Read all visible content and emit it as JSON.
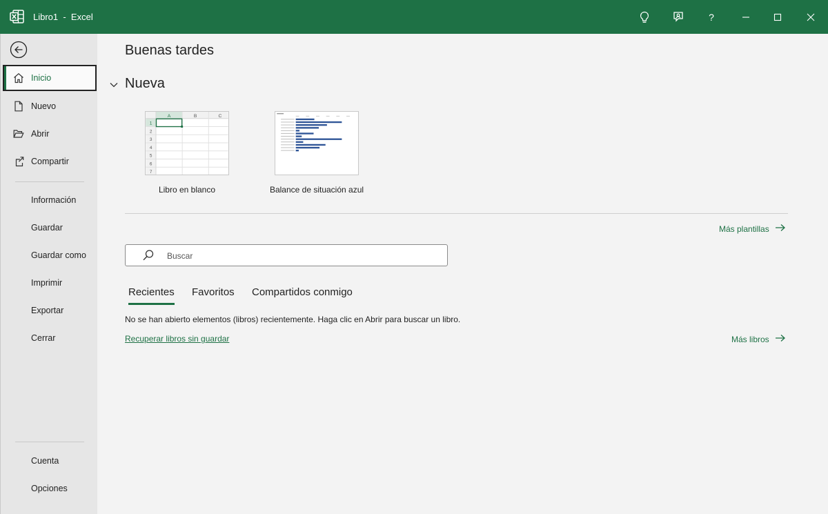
{
  "window": {
    "title": "Libro1  -  Excel",
    "accent": "#1e7145"
  },
  "titlebar": {
    "icons": [
      "excel-logo-icon",
      "lightbulb-icon",
      "feedback-icon",
      "help-icon",
      "minimize-icon",
      "maximize-icon",
      "close-icon"
    ],
    "help_label": "?"
  },
  "sidebar": {
    "back_icon": "back-arrow-icon",
    "primary": [
      {
        "label": "Inicio",
        "icon": "home-icon",
        "active": true
      },
      {
        "label": "Nuevo",
        "icon": "new-document-icon"
      },
      {
        "label": "Abrir",
        "icon": "folder-open-icon"
      },
      {
        "label": "Compartir",
        "icon": "share-icon"
      }
    ],
    "secondary": [
      {
        "label": "Información"
      },
      {
        "label": "Guardar"
      },
      {
        "label": "Guardar como"
      },
      {
        "label": "Imprimir"
      },
      {
        "label": "Exportar"
      },
      {
        "label": "Cerrar"
      }
    ],
    "footer": [
      {
        "label": "Cuenta"
      },
      {
        "label": "Opciones"
      }
    ]
  },
  "main": {
    "greeting": "Buenas tardes",
    "new_section": {
      "title": "Nueva",
      "templates": [
        {
          "label": "Libro en blanco",
          "columns": [
            "A",
            "B",
            "C"
          ],
          "rows": [
            "1",
            "2",
            "3",
            "4",
            "5",
            "6",
            "7"
          ]
        },
        {
          "label": "Balance de situación azul",
          "bars": [
            0.25,
            0.62,
            0.42,
            0.31,
            0.05,
            0.24,
            0.08,
            0.62,
            0.1,
            0.4,
            0.32,
            0.04
          ]
        }
      ]
    },
    "more_templates": "Más plantillas",
    "search": {
      "placeholder": "Buscar",
      "value": ""
    },
    "tabs": [
      {
        "label": "Recientes",
        "active": true
      },
      {
        "label": "Favoritos"
      },
      {
        "label": "Compartidos conmigo"
      }
    ],
    "empty_message": "No se han abierto elementos (libros) recientemente. Haga clic en Abrir para buscar un libro.",
    "recover_link": "Recuperar libros sin guardar",
    "more_books": "Más libros"
  }
}
